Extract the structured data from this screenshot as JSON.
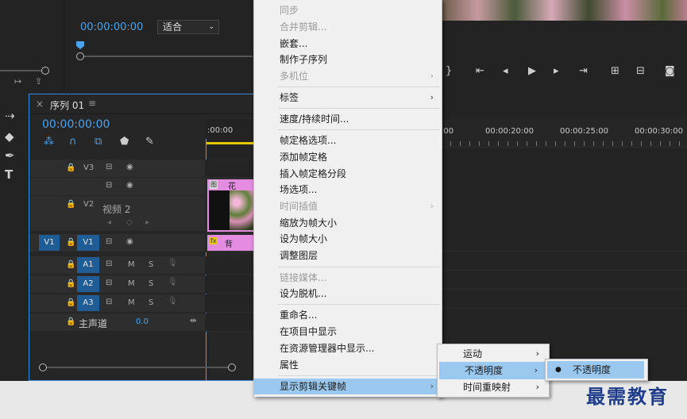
{
  "source_monitor": {
    "timecode": "00:00:00:00",
    "fit_select": "适合"
  },
  "sequence": {
    "tab_label": "序列 01",
    "timecode": "00:00:00:00",
    "ruler_start": ":00:00",
    "ruler_labels": [
      ":00",
      "00:00:20:00",
      "00:00:25:00",
      "00:00:30:00"
    ],
    "tracks": {
      "v3": "V3",
      "v2": "V2",
      "v2_name": "视频 2",
      "v1_src": "V1",
      "v1": "V1",
      "a1": "A1",
      "a2": "A2",
      "a3": "A3",
      "m": "M",
      "s": "S",
      "master": "主声道",
      "master_value": "0.0"
    },
    "clips": {
      "flower": "花儿.jpeg",
      "bg": "背景.jpeg",
      "fx": "fx",
      "clip_badge": "图"
    }
  },
  "context_menu": {
    "items": [
      {
        "label": "同步",
        "disabled": true
      },
      {
        "label": "合并剪辑...",
        "disabled": true
      },
      {
        "label": "嵌套...",
        "disabled": false
      },
      {
        "label": "制作子序列",
        "disabled": false
      },
      {
        "label": "多机位",
        "disabled": true,
        "submenu": true
      },
      {
        "label": "标签",
        "disabled": false,
        "submenu": true
      },
      {
        "label": "速度/持续时间...",
        "disabled": false
      },
      {
        "label": "帧定格选项...",
        "disabled": false
      },
      {
        "label": "添加帧定格",
        "disabled": false
      },
      {
        "label": "插入帧定格分段",
        "disabled": false
      },
      {
        "label": "场选项...",
        "disabled": false
      },
      {
        "label": "时间插值",
        "disabled": true,
        "submenu": true
      },
      {
        "label": "缩放为帧大小",
        "disabled": false
      },
      {
        "label": "设为帧大小",
        "disabled": false
      },
      {
        "label": "调整图层",
        "disabled": false
      },
      {
        "label": "链接媒体...",
        "disabled": true
      },
      {
        "label": "设为脱机...",
        "disabled": false
      },
      {
        "label": "重命名...",
        "disabled": false
      },
      {
        "label": "在项目中显示",
        "disabled": false
      },
      {
        "label": "在资源管理器中显示...",
        "disabled": false
      },
      {
        "label": "属性",
        "disabled": false
      },
      {
        "label": "显示剪辑关键帧",
        "disabled": false,
        "submenu": true,
        "highlighted": true
      }
    ],
    "arrow": "›"
  },
  "submenu1": {
    "items": [
      {
        "label": "运动"
      },
      {
        "label": "不透明度",
        "highlighted": true
      },
      {
        "label": "时间重映射"
      }
    ]
  },
  "submenu2": {
    "item": "不透明度",
    "bullet": "●"
  },
  "watermark": "最需教育",
  "colors": {
    "accent_blue": "#4aa3f0",
    "menu_highlight": "#9ac8ee",
    "clip_pink": "#e48ce0",
    "track_blue": "#1f5d94"
  }
}
